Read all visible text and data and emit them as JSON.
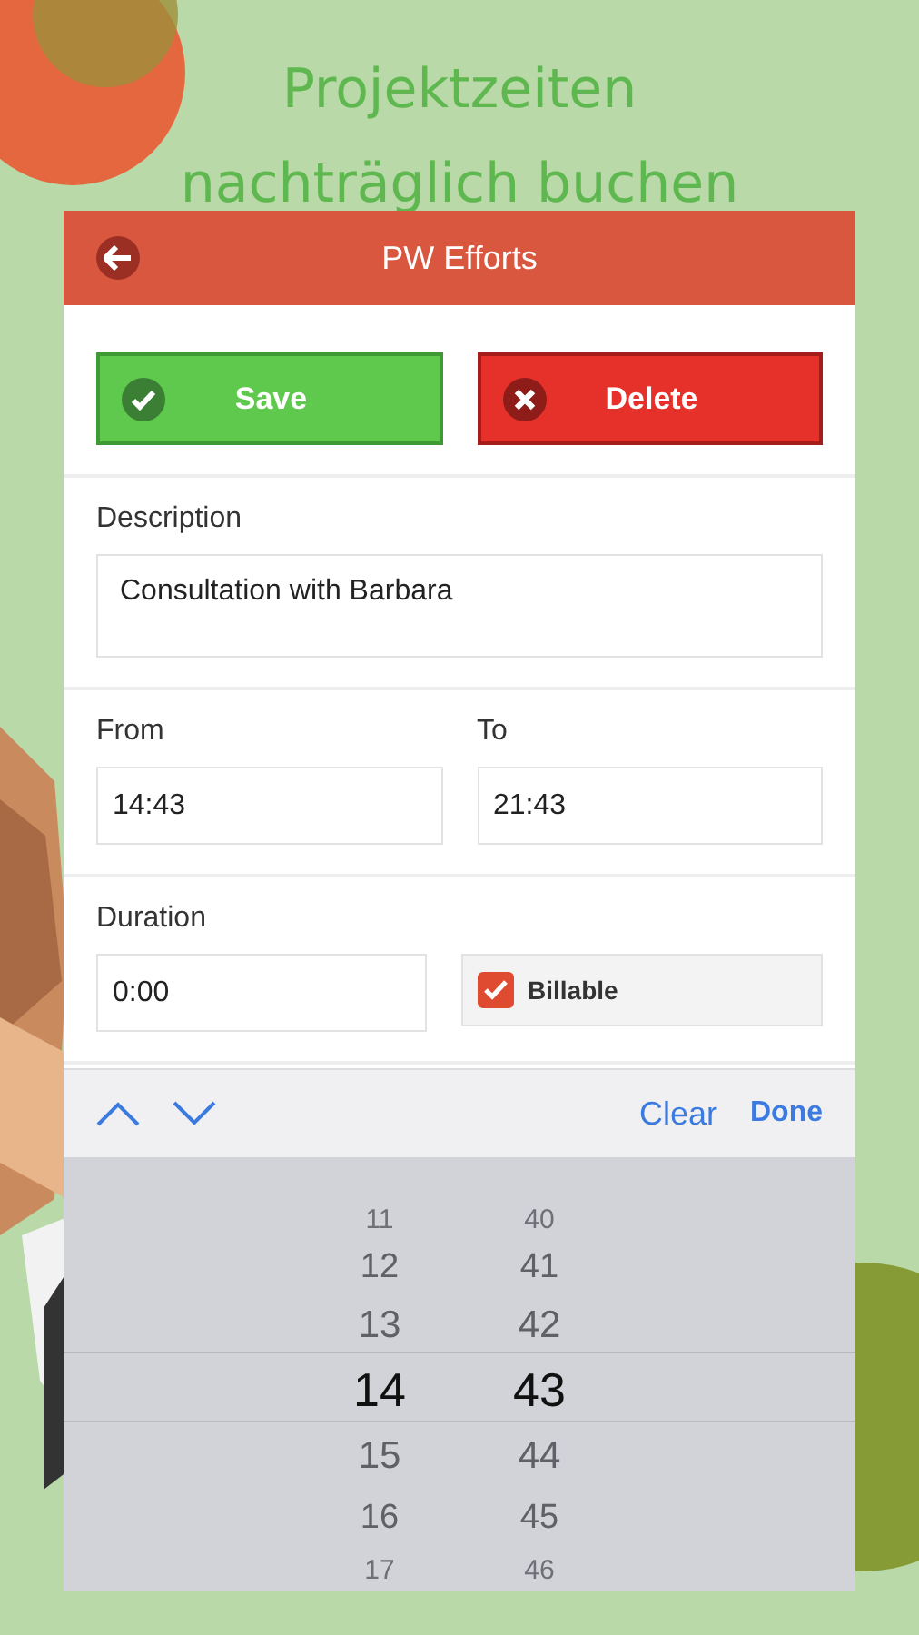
{
  "headline": [
    "Projektzeiten",
    "nachträglich buchen"
  ],
  "header": {
    "title": "PW Efforts"
  },
  "buttons": [
    {
      "label": "Save",
      "kind": "save"
    },
    {
      "label": "Delete",
      "kind": "delete"
    }
  ],
  "description": {
    "label": "Description",
    "value": "Consultation with Barbara"
  },
  "times": [
    {
      "label": "From",
      "value": "14:43"
    },
    {
      "label": "To",
      "value": "21:43"
    }
  ],
  "duration": {
    "label": "Duration",
    "value": "0:00"
  },
  "billable": {
    "label": "Billable",
    "checked": true
  },
  "toolbar": {
    "clear": "Clear",
    "done": "Done"
  },
  "picker": {
    "hours": [
      {
        "value": "11",
        "selected": false
      },
      {
        "value": "12",
        "selected": false
      },
      {
        "value": "13",
        "selected": false
      },
      {
        "value": "14",
        "selected": true
      },
      {
        "value": "15",
        "selected": false
      },
      {
        "value": "16",
        "selected": false
      },
      {
        "value": "17",
        "selected": false
      }
    ],
    "minutes": [
      {
        "value": "40",
        "selected": false
      },
      {
        "value": "41",
        "selected": false
      },
      {
        "value": "42",
        "selected": false
      },
      {
        "value": "43",
        "selected": true
      },
      {
        "value": "44",
        "selected": false
      },
      {
        "value": "45",
        "selected": false
      },
      {
        "value": "46",
        "selected": false
      }
    ]
  }
}
